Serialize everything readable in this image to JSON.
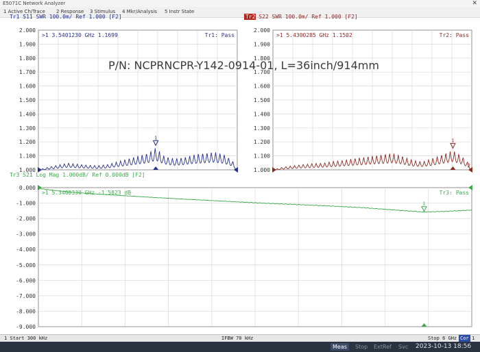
{
  "window": {
    "title": "E5071C Network Analyzer",
    "close_glyph": "✕"
  },
  "menu": [
    "1 Active Ch/Trace",
    "2 Response",
    "3 Stimulus",
    "4 Mkr/Analysis",
    "5 Instr State"
  ],
  "overlay_label": "P/N: NCPRNCPR-Y142-0914-01, L=36inch/914mm",
  "colors": {
    "tr1": "#27308a",
    "tr2": "#8c2a24",
    "tr3": "#3aa84a",
    "grid": "#d8d8d8",
    "frame": "#909090",
    "bottom_bar": "#2b3240"
  },
  "status": {
    "start": "1  Start 300 kHz",
    "ifbw": "IFBW 70 kHz",
    "stop": "Stop 6 GHz",
    "cor": "Cor",
    "one": "1"
  },
  "bottom": {
    "meas": "Meas",
    "stop": "Stop",
    "extref": "ExtRef",
    "svc": "Svc",
    "datetime": "2023-10-13 18:56"
  },
  "chart_data": [
    {
      "type": "line",
      "header": "Tr1 S11 SWR 100.0m/ Ref 1.000 [F2]",
      "marker_readout": ">1  3.5401230 GHz  1.1699",
      "status": "Tr1: Pass",
      "marker_label": "1",
      "y_ticks": [
        "2.000",
        "1.900",
        "1.800",
        "1.700",
        "1.600",
        "1.500",
        "1.400",
        "1.300",
        "1.200",
        "1.100",
        "1.000"
      ],
      "ylim": [
        1.0,
        2.0
      ],
      "xlim_hz": [
        300000,
        6000000000
      ],
      "marker": {
        "x_ghz": 3.540123,
        "y": 1.1699
      },
      "series": [
        {
          "x_ghz": [
            0.0003,
            0.3,
            0.6,
            0.9,
            1.2,
            1.5,
            1.8,
            2.1,
            2.4,
            2.7,
            3.0,
            3.3,
            3.54,
            3.8,
            4.1,
            4.4,
            4.7,
            5.0,
            5.3,
            5.6,
            5.85,
            6.0
          ],
          "y": [
            1.0,
            1.02,
            1.035,
            1.05,
            1.04,
            1.035,
            1.03,
            1.04,
            1.06,
            1.08,
            1.1,
            1.12,
            1.16,
            1.1,
            1.08,
            1.09,
            1.11,
            1.12,
            1.13,
            1.11,
            1.07,
            1.0
          ]
        }
      ]
    },
    {
      "type": "line",
      "header": "Tr2 S22 SWR 100.0m/ Ref 1.000 [F2]",
      "marker_readout": ">1  5.4300285 GHz  1.1502",
      "status": "Tr2: Pass",
      "marker_label": "1",
      "marker_label_2": "2",
      "y_ticks": [
        "2.000",
        "1.900",
        "1.800",
        "1.700",
        "1.600",
        "1.500",
        "1.400",
        "1.300",
        "1.200",
        "1.100",
        "1.000"
      ],
      "ylim": [
        1.0,
        2.0
      ],
      "xlim_hz": [
        300000,
        6000000000
      ],
      "marker": {
        "x_ghz": 5.4300285,
        "y": 1.1502
      },
      "series": [
        {
          "x_ghz": [
            0.0003,
            0.3,
            0.6,
            0.9,
            1.2,
            1.5,
            1.8,
            2.1,
            2.4,
            2.7,
            3.0,
            3.3,
            3.6,
            3.9,
            4.2,
            4.5,
            4.8,
            5.1,
            5.43,
            5.7,
            5.9,
            6.0
          ],
          "y": [
            1.0,
            1.02,
            1.03,
            1.04,
            1.045,
            1.05,
            1.06,
            1.07,
            1.08,
            1.09,
            1.1,
            1.11,
            1.12,
            1.1,
            1.07,
            1.06,
            1.08,
            1.11,
            1.14,
            1.1,
            1.05,
            1.0
          ]
        }
      ]
    },
    {
      "type": "line",
      "header": "Tr3 S21 Log Mag 1.000dB/ Ref 0.000dB [F2]",
      "marker_readout": ">1  5.3400330 GHz -1.5823 dB",
      "status": "Tr3: Pass",
      "marker_label": "1",
      "y_ticks": [
        "0.000",
        "-1.000",
        "-2.000",
        "-3.000",
        "-4.000",
        "-5.000",
        "-6.000",
        "-7.000",
        "-8.000",
        "-9.000"
      ],
      "ylim": [
        -9.0,
        0.0
      ],
      "ylabel_unit": "dB",
      "xlim_hz": [
        300000,
        6000000000
      ],
      "marker": {
        "x_ghz": 5.340033,
        "y": -1.5823
      },
      "series": [
        {
          "x_ghz": [
            0.0003,
            0.05,
            0.3,
            0.6,
            1.0,
            1.5,
            2.0,
            2.5,
            3.0,
            3.5,
            4.0,
            4.5,
            5.0,
            5.34,
            5.7,
            6.0
          ],
          "y": [
            0.0,
            -0.08,
            -0.22,
            -0.35,
            -0.47,
            -0.61,
            -0.74,
            -0.86,
            -0.98,
            -1.08,
            -1.18,
            -1.3,
            -1.47,
            -1.58,
            -1.52,
            -1.45
          ]
        }
      ]
    }
  ]
}
